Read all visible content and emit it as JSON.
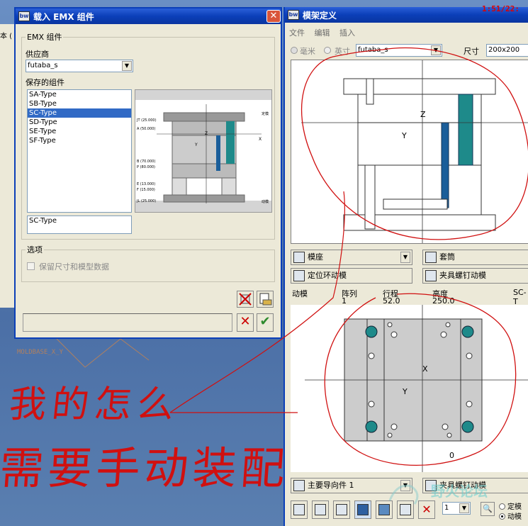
{
  "left_strip": {
    "label": "本 ("
  },
  "load_dialog": {
    "title": "载入 EMX 组件",
    "emx_group": "EMX 组件",
    "vendor_label": "供应商",
    "vendor_value": "futaba_s",
    "saved_label": "保存的组件",
    "saved_items": [
      "SA-Type",
      "SB-Type",
      "SC-Type",
      "SD-Type",
      "SE-Type",
      "SF-Type"
    ],
    "selected_item": "SC-Type",
    "selected_value": "SC-Type",
    "options_label": "选项",
    "keep_dims_label": "保留尺寸和模型数据",
    "preview_labels": {
      "jt": "JT (25.000)",
      "a": "A (50.000)",
      "z": "Z",
      "y": "Y",
      "x": "X",
      "b": "B (70.000)",
      "p": "P (80.000)",
      "e": "E (13.000)",
      "f": "F (15.000)",
      "jl": "JL (25.000)",
      "fixed": "定模",
      "moving": "动模"
    }
  },
  "moldbase_label": "MOLDBASE_X_Y",
  "mold_window": {
    "title": "模架定义",
    "clock": "1:51/22:",
    "menu": [
      "文件",
      "编辑",
      "插入"
    ],
    "unit_mm": "毫米",
    "unit_inch": "英寸",
    "vendor_value": "futaba_s",
    "size_label": "尺寸",
    "size_value": "200x200",
    "top_view_labels": {
      "z": "Z",
      "y": "Y"
    },
    "combo_base": "模座",
    "btn_sleeve": "套筒",
    "btn_locating_ring": "定位环动模",
    "btn_clamp_screw": "夹具螺钉动模",
    "row_headers": [
      "动模",
      "阵列",
      "行程",
      "高度",
      "SC-T"
    ],
    "row_values": [
      "1",
      "52.0",
      "250.0"
    ],
    "bottom_view_labels": {
      "x": "X",
      "y": "Y",
      "o": "0"
    },
    "combo_guide": "主要导向件 1",
    "btn_clamp_screw2": "夹具螺钉动模",
    "small_combo": "1",
    "radio_fixed": "定模",
    "radio_moving": "动模"
  },
  "handwriting": [
    "我的怎么",
    "需要手动装配"
  ],
  "watermark": "野火论坛",
  "colors": {
    "titlebar": "#0b3fb8",
    "accent_teal": "#1e8a8a",
    "cancel_red": "#cc0000",
    "ok_green": "#2e8b2e",
    "annotation_red": "#d01010"
  }
}
